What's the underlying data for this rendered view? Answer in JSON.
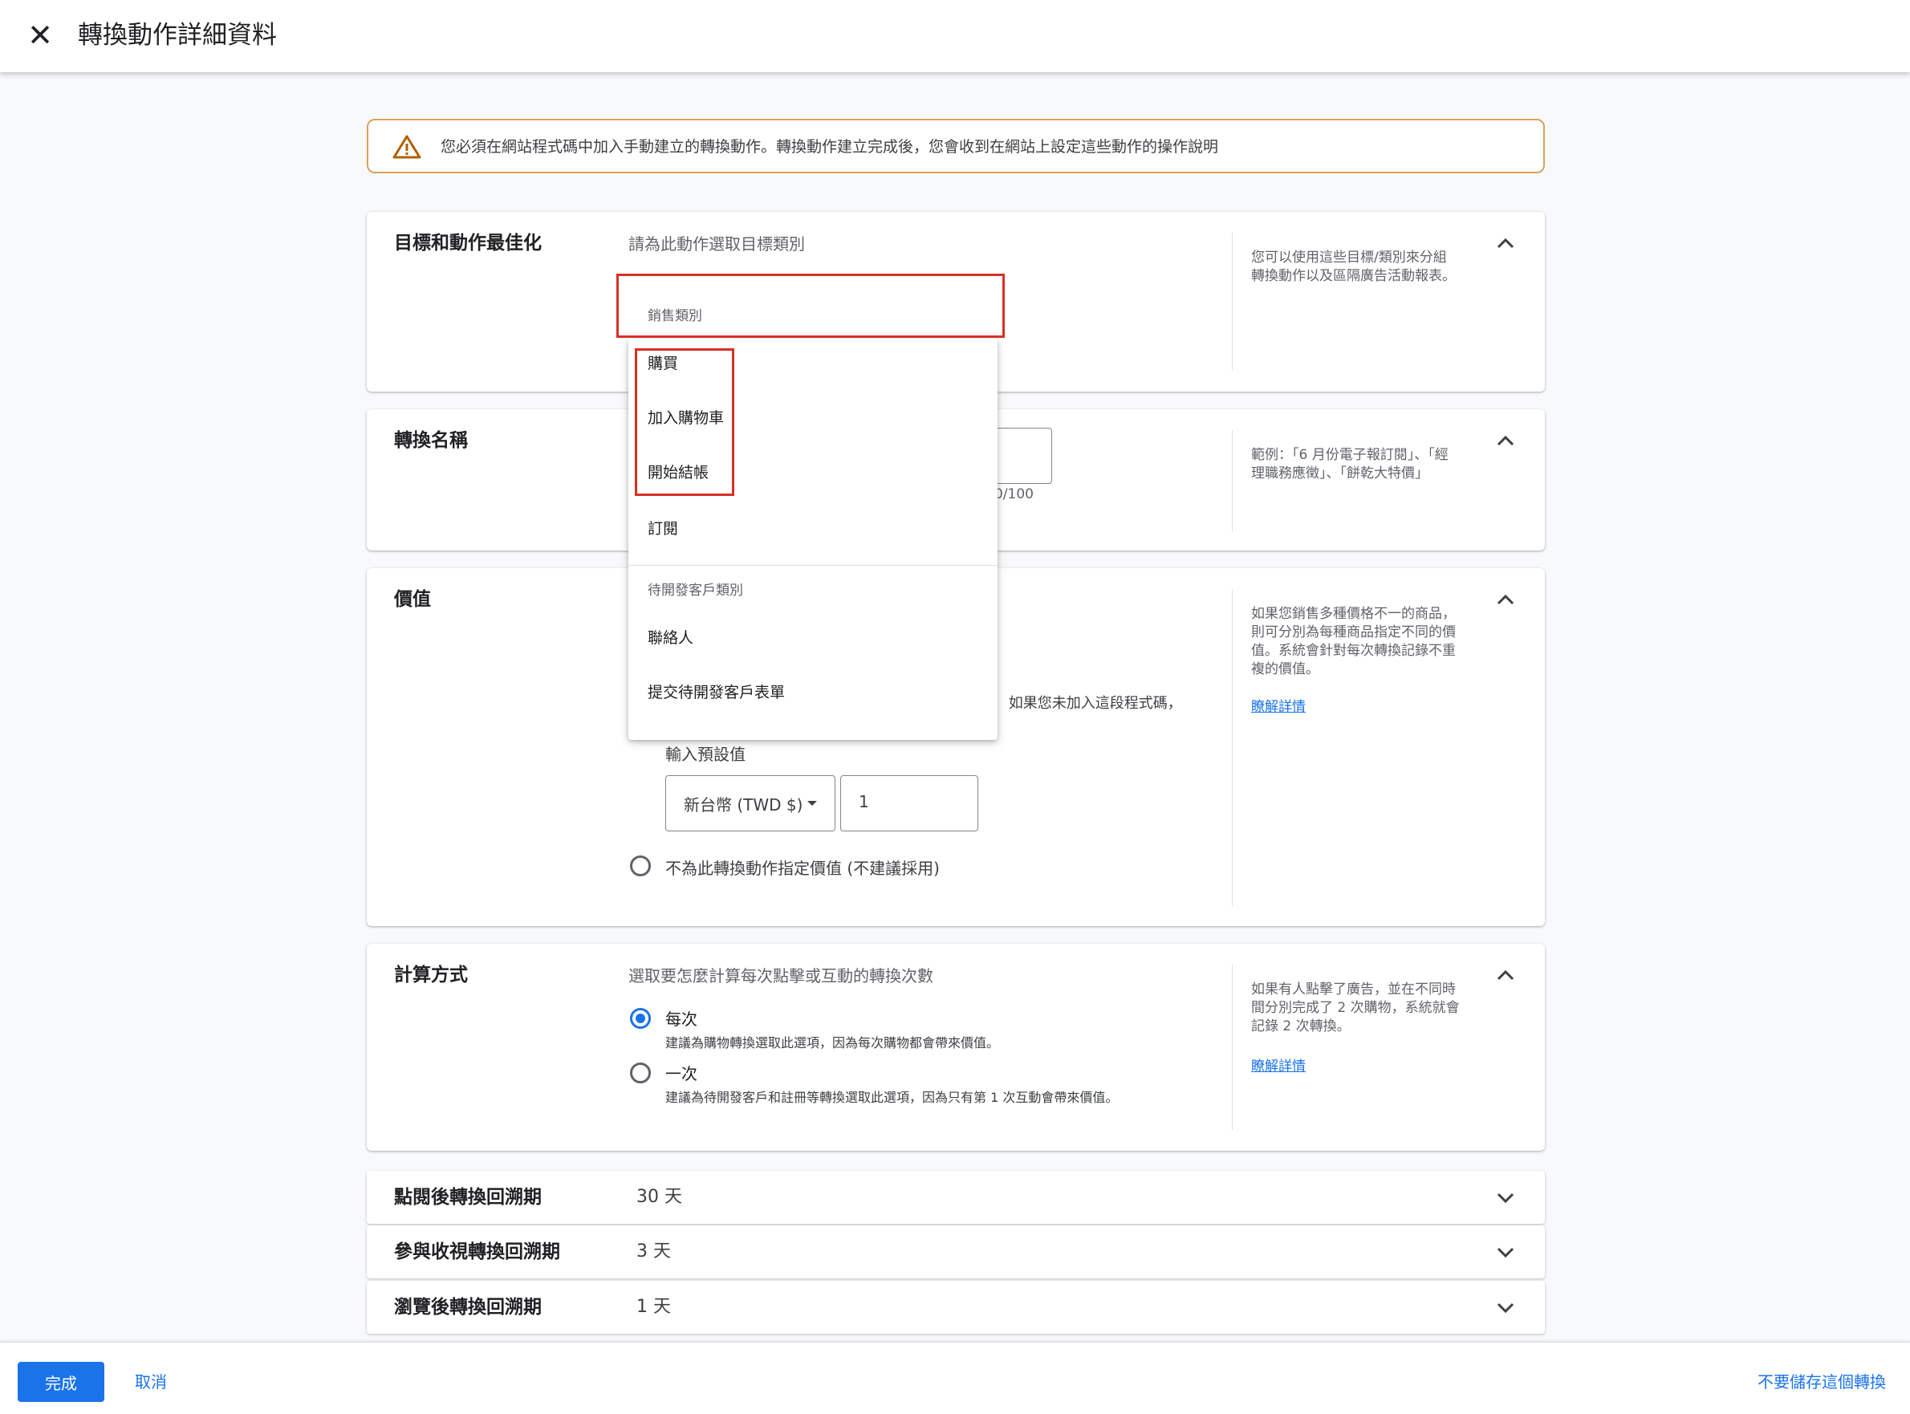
{
  "header": {
    "title": "轉換動作詳細資料",
    "close_icon": "close-icon"
  },
  "warning": {
    "text": "您必須在網站程式碼中加入手動建立的轉換動作。轉換動作建立完成後，您會收到在網站上設定這些動作的操作說明"
  },
  "goal": {
    "label": "目標和動作最佳化",
    "prompt": "請為此動作選取目標類別",
    "help": "您可以使用這些目標/類別來分組轉換動作以及區隔廣告活動報表。"
  },
  "dropdown": {
    "sales_header": "銷售類別",
    "sales_items": [
      "購買",
      "加入購物車",
      "開始結帳",
      "訂閱"
    ],
    "leads_header": "待開發客戶類別",
    "leads_items": [
      "聯絡人",
      "提交待開發客戶表單"
    ]
  },
  "name": {
    "label": "轉換名稱",
    "counter": "0/100",
    "help": "範例：「6 月份電子報訂閱」、「經理職務應徵」、「餅乾大特價」"
  },
  "value": {
    "label": "價值",
    "partial_text": "。 如果您未加入這段程式碼，",
    "default_label": "輸入預設值",
    "currency": "新台幣 (TWD $)",
    "amount": "1",
    "no_value_option": "不為此轉換動作指定價值 (不建議採用)",
    "help": "如果您銷售多種價格不一的商品，則可分別為每種商品指定不同的價值。系統會針對每次轉換記錄不重複的價值。",
    "learn_more": "瞭解詳情"
  },
  "counting": {
    "label": "計算方式",
    "prompt": "選取要怎麼計算每次點擊或互動的轉換次數",
    "option1": "每次",
    "option1_desc": "建議為購物轉換選取此選項，因為每次購物都會帶來價值。",
    "option2": "一次",
    "option2_desc": "建議為待開發客戶和註冊等轉換選取此選項，因為只有第 1 次互動會帶來價值。",
    "help": "如果有人點擊了廣告，並在不同時間分別完成了 2 次購物，系統就會記錄 2 次轉換。",
    "learn_more": "瞭解詳情"
  },
  "windows": [
    {
      "label": "點閱後轉換回溯期",
      "value": "30 天"
    },
    {
      "label": "參與收視轉換回溯期",
      "value": "3 天"
    },
    {
      "label": "瀏覽後轉換回溯期",
      "value": "1 天"
    }
  ],
  "footer": {
    "done": "完成",
    "cancel": "取消",
    "discard": "不要儲存這個轉換"
  },
  "colors": {
    "accent": "#1a73e8",
    "highlight": "#d93025",
    "warning_border": "#d7a25d"
  }
}
